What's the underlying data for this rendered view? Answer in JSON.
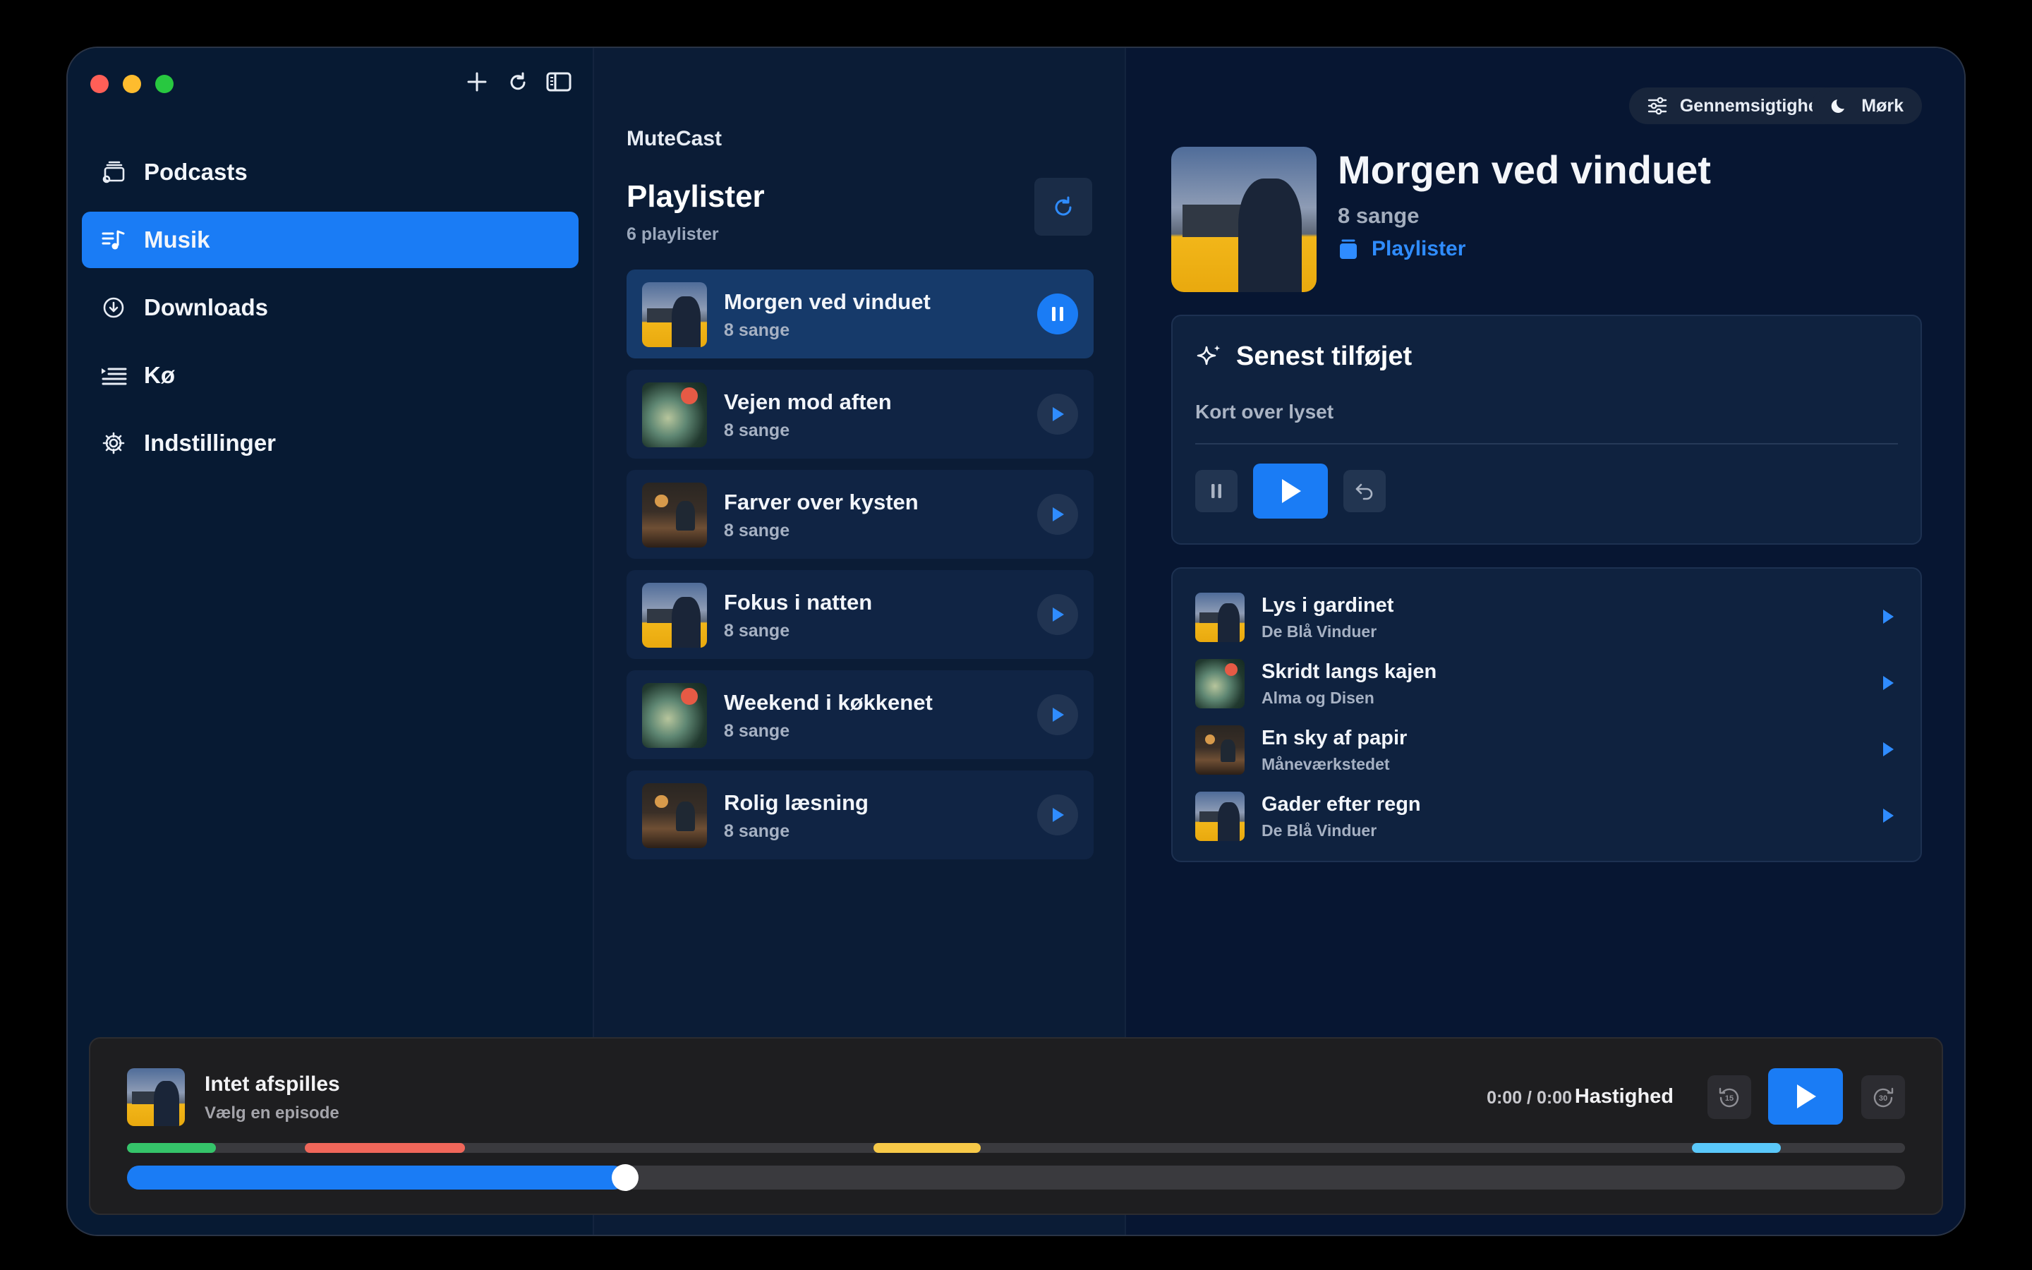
{
  "sidebar": {
    "items": [
      {
        "label": "Podcasts",
        "icon": "podcast-stack-icon"
      },
      {
        "label": "Musik",
        "icon": "music-list-icon",
        "active": true
      },
      {
        "label": "Downloads",
        "icon": "download-circle-icon"
      },
      {
        "label": "Kø",
        "icon": "queue-list-icon"
      },
      {
        "label": "Indstillinger",
        "icon": "gear-icon"
      }
    ]
  },
  "middle": {
    "brand": "MuteCast",
    "title": "Playlister",
    "count": "6 playlister",
    "playlists": [
      {
        "name": "Morgen ved vinduet",
        "sub": "8 sange",
        "art": "city",
        "playing": true
      },
      {
        "name": "Vejen mod aften",
        "sub": "8 sange",
        "art": "map"
      },
      {
        "name": "Farver over kysten",
        "sub": "8 sange",
        "art": "table"
      },
      {
        "name": "Fokus i natten",
        "sub": "8 sange",
        "art": "city"
      },
      {
        "name": "Weekend i køkkenet",
        "sub": "8 sange",
        "art": "map"
      },
      {
        "name": "Rolig læsning",
        "sub": "8 sange",
        "art": "table"
      }
    ]
  },
  "detail": {
    "pill_transparency": "Gennemsigtighed",
    "pill_dark": "Mørk",
    "title": "Morgen ved vinduet",
    "subtitle": "8 sange",
    "link": "Playlister",
    "recent": {
      "title": "Senest tilføjet",
      "subtitle": "Kort over lyset"
    },
    "tracks": [
      {
        "name": "Lys i gardinet",
        "artist": "De Blå Vinduer",
        "art": "city"
      },
      {
        "name": "Skridt langs kajen",
        "artist": "Alma og Disen",
        "art": "map"
      },
      {
        "name": "En sky af papir",
        "artist": "Måneværkstedet",
        "art": "table"
      },
      {
        "name": "Gader efter regn",
        "artist": "De Blå Vinduer",
        "art": "city"
      }
    ]
  },
  "player": {
    "title": "Intet afspilles",
    "subtitle": "Vælg en episode",
    "time": "0:00 / 0:00",
    "speed": "Hastighed",
    "skip_back": "15",
    "skip_forward": "30",
    "progress": 0.28,
    "chapters": [
      {
        "start": 0.0,
        "end": 0.05,
        "color": "#35c46a"
      },
      {
        "start": 0.1,
        "end": 0.19,
        "color": "#f0675a"
      },
      {
        "start": 0.42,
        "end": 0.48,
        "color": "#f7c948"
      },
      {
        "start": 0.88,
        "end": 0.93,
        "color": "#5ac8fa"
      }
    ]
  },
  "colors": {
    "accent": "#1a7cf5"
  }
}
